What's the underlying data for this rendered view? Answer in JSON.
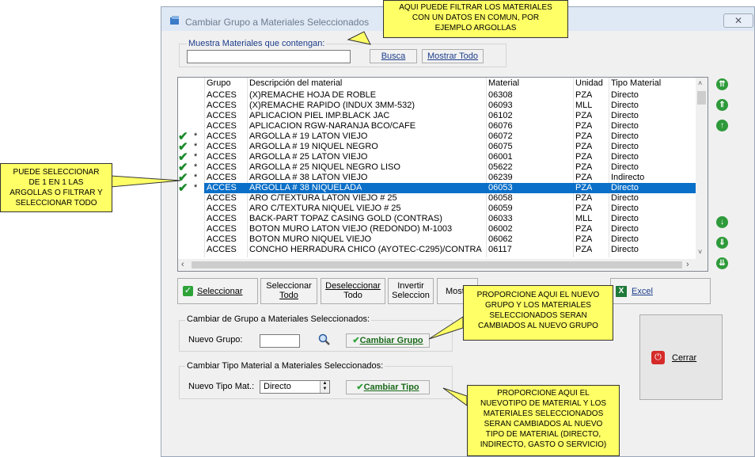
{
  "window": {
    "title": "Cambiar Grupo a Materiales Seleccionados",
    "close": "✕"
  },
  "filter": {
    "label": "Muestra Materiales que contengan:",
    "value": "",
    "search_btn": "Busca",
    "show_all_btn": "Mostrar Todo"
  },
  "grid": {
    "columns": [
      "Grupo",
      "Descripción del material",
      "Material",
      "Unidad",
      "Tipo Material"
    ],
    "rows": [
      {
        "mark": "",
        "grupo": "ACCES",
        "desc": "(X)REMACHE HOJA DE ROBLE",
        "material": "06308",
        "unidad": "PZA",
        "tipo": "Directo"
      },
      {
        "mark": "",
        "grupo": "ACCES",
        "desc": "(X)REMACHE RAPIDO (INDUX 3MM-532)",
        "material": "06093",
        "unidad": "MLL",
        "tipo": "Directo"
      },
      {
        "mark": "",
        "grupo": "ACCES",
        "desc": "APLICACION PIEL IMP.BLACK JAC",
        "material": "06102",
        "unidad": "PZA",
        "tipo": "Directo"
      },
      {
        "mark": "",
        "grupo": "ACCES",
        "desc": "APLICACION RGW-NARANJA BCO/CAFE",
        "material": "06076",
        "unidad": "PZA",
        "tipo": "Directo"
      },
      {
        "mark": "*",
        "grupo": "ACCES",
        "desc": "ARGOLLA # 19 LATON VIEJO",
        "material": "06072",
        "unidad": "PZA",
        "tipo": "Directo"
      },
      {
        "mark": "*",
        "grupo": "ACCES",
        "desc": "ARGOLLA # 19 NIQUEL  NEGRO",
        "material": "06075",
        "unidad": "PZA",
        "tipo": "Directo"
      },
      {
        "mark": "*",
        "grupo": "ACCES",
        "desc": "ARGOLLA # 25 LATON VIEJO",
        "material": "06001",
        "unidad": "PZA",
        "tipo": "Directo"
      },
      {
        "mark": "*",
        "grupo": "ACCES",
        "desc": "ARGOLLA # 25 NIQUEL NEGRO LISO",
        "material": "05622",
        "unidad": "PZA",
        "tipo": "Directo"
      },
      {
        "mark": "*",
        "grupo": "ACCES",
        "desc": "ARGOLLA # 38 LATON VIEJO",
        "material": "06239",
        "unidad": "PZA",
        "tipo": "Indirecto"
      },
      {
        "mark": "*",
        "grupo": "ACCES",
        "desc": "ARGOLLA # 38 NIQUELADA",
        "material": "06053",
        "unidad": "PZA",
        "tipo": "Directo"
      },
      {
        "mark": "",
        "grupo": "ACCES",
        "desc": "ARO C/TEXTURA LATON VIEJO # 25",
        "material": "06058",
        "unidad": "PZA",
        "tipo": "Directo"
      },
      {
        "mark": "",
        "grupo": "ACCES",
        "desc": "ARO C/TEXTURA NIQUEL VIEJO # 25",
        "material": "06059",
        "unidad": "PZA",
        "tipo": "Directo"
      },
      {
        "mark": "",
        "grupo": "ACCES",
        "desc": "BACK-PART TOPAZ CASING GOLD (CONTRAS)",
        "material": "06033",
        "unidad": "MLL",
        "tipo": "Directo"
      },
      {
        "mark": "",
        "grupo": "ACCES",
        "desc": "BOTON MURO LATON VIEJO (REDONDO) M-1003",
        "material": "06002",
        "unidad": "PZA",
        "tipo": "Directo"
      },
      {
        "mark": "",
        "grupo": "ACCES",
        "desc": "BOTON MURO NIQUEL VIEJO",
        "material": "06062",
        "unidad": "PZA",
        "tipo": "Directo"
      },
      {
        "mark": "",
        "grupo": "ACCES",
        "desc": "CONCHO HERRADURA CHICO (AYOTEC-C295)/CONTRA",
        "material": "06117",
        "unidad": "PZA",
        "tipo": "Directo"
      }
    ]
  },
  "buttons": {
    "seleccionar": "Seleccionar",
    "sel_todo_1": "Seleccionar",
    "sel_todo_2": "Todo",
    "desel_1": "Deseleccionar",
    "desel_2": "Todo",
    "invertir_1": "Invertir",
    "invertir_2": "Seleccion",
    "mostrar": "Mostr",
    "excel": "Excel",
    "cerrar": "Cerrar"
  },
  "grupo_section": {
    "title": "Cambiar de Grupo a Materiales Seleccionados:",
    "label": "Nuevo Grupo:",
    "value": "",
    "btn": "Cambiar Grupo"
  },
  "tipo_section": {
    "title": "Cambiar Tipo Material a Materiales Seleccionados:",
    "label": "Nuevo Tipo Mat.:",
    "value": "Directo",
    "btn": "Cambiar Tipo"
  },
  "callouts": {
    "top": [
      "AQUI PUEDE FILTRAR LOS MATERIALES",
      "CON UN DATOS EN COMUN, POR",
      "EJEMPLO ARGOLLAS"
    ],
    "left": [
      "PUEDE SELECCIONAR",
      "DE 1 EN 1 LAS",
      "ARGOLLAS O FILTRAR Y",
      "SELECCIONAR TODO"
    ],
    "mid": [
      "PROPORCIONE AQUI EL NUEVO",
      "GRUPO Y LOS MATERIALES",
      "SELECCIONADOS SERAN",
      "CAMBIADOS AL NUEVO GRUPO"
    ],
    "bottom": [
      "PROPORCIONE AQUI EL",
      "NUEVOTIPO DE MATERIAL Y  LOS",
      "MATERIALES SELECCIONADOS",
      "SERAN CAMBIADOS AL NUEVO",
      "TIPO DE MATERIAL (DIRECTO,",
      "INDIRECTO, GASTO O SERVICIO)"
    ]
  },
  "colors": {
    "selection": "#0a6fc8",
    "callout": "#ffff66",
    "nav_green": "#2e9a3a"
  },
  "icons": [
    "app-icon",
    "close-icon",
    "checkmark-icon",
    "magnifier-icon",
    "excel-icon",
    "power-icon",
    "up-arrow-icon",
    "down-arrow-icon"
  ]
}
